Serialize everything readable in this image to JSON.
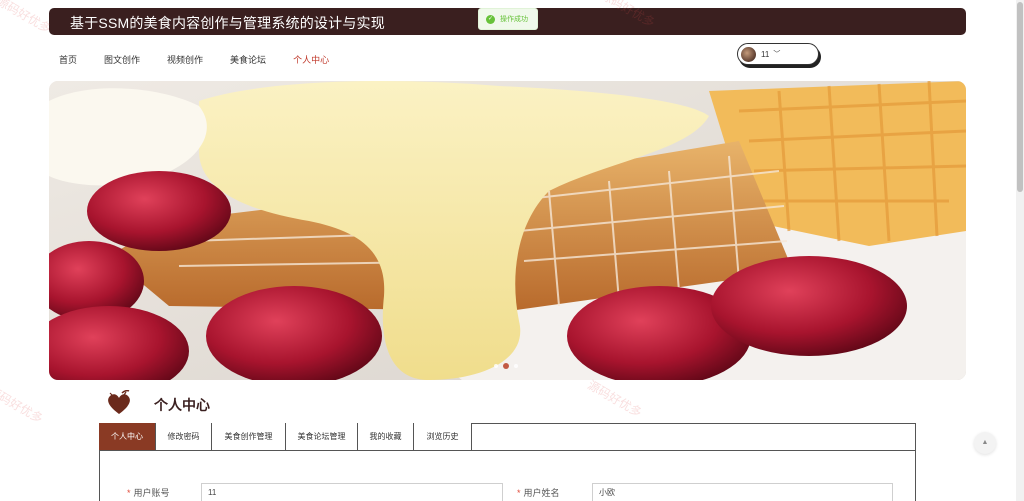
{
  "header": {
    "title": "基于SSM的美食内容创作与管理系统的设计与实现"
  },
  "toast": {
    "message": "操作成功",
    "icon": "check-circle-icon",
    "color": "#67c23a"
  },
  "nav": {
    "items": [
      {
        "label": "首页",
        "active": false
      },
      {
        "label": "图文创作",
        "active": false
      },
      {
        "label": "视频创作",
        "active": false
      },
      {
        "label": "美食论坛",
        "active": false
      },
      {
        "label": "个人中心",
        "active": true
      }
    ]
  },
  "user": {
    "name": "11",
    "caret": "﹀"
  },
  "banner": {
    "slides": 3,
    "active_slide": 2
  },
  "section": {
    "title": "个人中心",
    "icon": "chocolate-heart-icon"
  },
  "tabs": [
    {
      "label": "个人中心",
      "active": true
    },
    {
      "label": "修改密码",
      "active": false
    },
    {
      "label": "美食创作管理",
      "active": false
    },
    {
      "label": "美食论坛管理",
      "active": false
    },
    {
      "label": "我的收藏",
      "active": false
    },
    {
      "label": "浏览历史",
      "active": false
    }
  ],
  "form": {
    "account_label": "用户账号",
    "account_value": "11",
    "name_label": "用户姓名",
    "name_value": "小欧",
    "required_mark": "*"
  },
  "back_to_top": {
    "icon": "arrow-up-icon",
    "glyph": "▲"
  },
  "watermark": {
    "text": "源码好优多"
  },
  "colors": {
    "header_bg": "#3a1f1f",
    "accent": "#8a3a24",
    "nav_active": "#c0392b"
  }
}
